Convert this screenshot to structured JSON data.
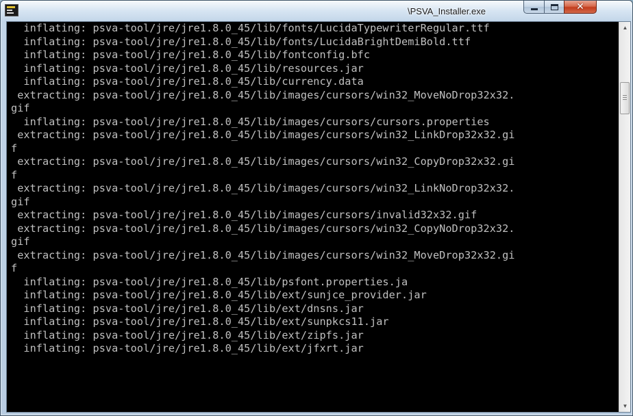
{
  "window": {
    "title": "\\PSVA_Installer.exe",
    "icon": "console-app-icon"
  },
  "caption_buttons": {
    "minimize": "minimize-icon",
    "maximize": "maximize-icon",
    "close": "close-icon"
  },
  "console": {
    "lines": [
      "  inflating: psva-tool/jre/jre1.8.0_45/lib/fonts/LucidaTypewriterRegular.ttf",
      "  inflating: psva-tool/jre/jre1.8.0_45/lib/fonts/LucidaBrightDemiBold.ttf",
      "  inflating: psva-tool/jre/jre1.8.0_45/lib/fontconfig.bfc",
      "  inflating: psva-tool/jre/jre1.8.0_45/lib/resources.jar",
      "  inflating: psva-tool/jre/jre1.8.0_45/lib/currency.data",
      " extracting: psva-tool/jre/jre1.8.0_45/lib/images/cursors/win32_MoveNoDrop32x32.",
      "gif",
      "  inflating: psva-tool/jre/jre1.8.0_45/lib/images/cursors/cursors.properties",
      " extracting: psva-tool/jre/jre1.8.0_45/lib/images/cursors/win32_LinkDrop32x32.gi",
      "f",
      " extracting: psva-tool/jre/jre1.8.0_45/lib/images/cursors/win32_CopyDrop32x32.gi",
      "f",
      " extracting: psva-tool/jre/jre1.8.0_45/lib/images/cursors/win32_LinkNoDrop32x32.",
      "gif",
      " extracting: psva-tool/jre/jre1.8.0_45/lib/images/cursors/invalid32x32.gif",
      " extracting: psva-tool/jre/jre1.8.0_45/lib/images/cursors/win32_CopyNoDrop32x32.",
      "gif",
      " extracting: psva-tool/jre/jre1.8.0_45/lib/images/cursors/win32_MoveDrop32x32.gi",
      "f",
      "  inflating: psva-tool/jre/jre1.8.0_45/lib/psfont.properties.ja",
      "  inflating: psva-tool/jre/jre1.8.0_45/lib/ext/sunjce_provider.jar",
      "  inflating: psva-tool/jre/jre1.8.0_45/lib/ext/dnsns.jar",
      "  inflating: psva-tool/jre/jre1.8.0_45/lib/ext/sunpkcs11.jar",
      "  inflating: psva-tool/jre/jre1.8.0_45/lib/ext/zipfs.jar",
      "  inflating: psva-tool/jre/jre1.8.0_45/lib/ext/jfxrt.jar"
    ]
  },
  "colors": {
    "console_background": "#000000",
    "console_text": "#c0c0c0",
    "close_button": "#c8452a"
  }
}
